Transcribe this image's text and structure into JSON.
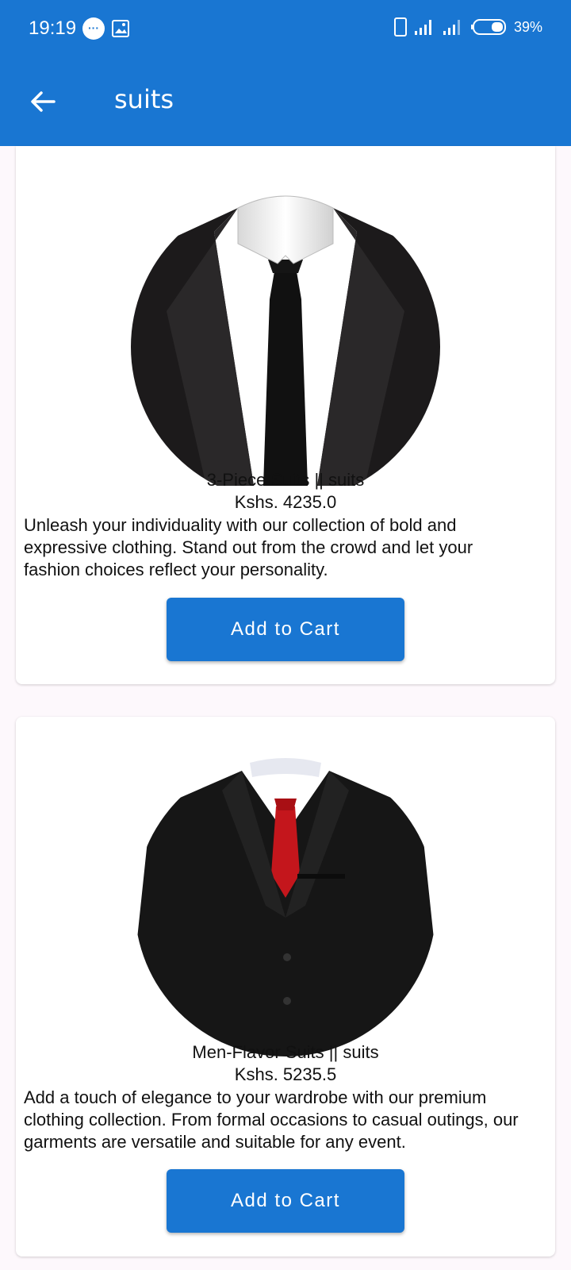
{
  "status_bar": {
    "time": "19:19",
    "battery": "39%",
    "icons": [
      "message-icon",
      "image-icon",
      "phone-icon",
      "signal-icon",
      "signal-icon",
      "battery-icon"
    ]
  },
  "toolbar": {
    "title": "suits",
    "back_icon": "arrow-left-icon"
  },
  "colors": {
    "primary": "#1976d2",
    "background": "#fdf8fc",
    "card": "#ffffff"
  },
  "products": [
    {
      "name": "3-Piece Suits || suits",
      "price": "Kshs. 4235.0",
      "description": "Unleash your individuality with our collection of bold and expressive clothing. Stand out from the crowd and let your fashion choices reflect your personality.",
      "button": "Add to Cart"
    },
    {
      "name": "Men-Flavor Suits || suits",
      "price": "Kshs. 5235.5",
      "description": "Add a touch of elegance to your wardrobe with our premium clothing collection. From formal occasions to casual outings, our garments are versatile and suitable for any event.",
      "button": "Add to Cart"
    }
  ]
}
